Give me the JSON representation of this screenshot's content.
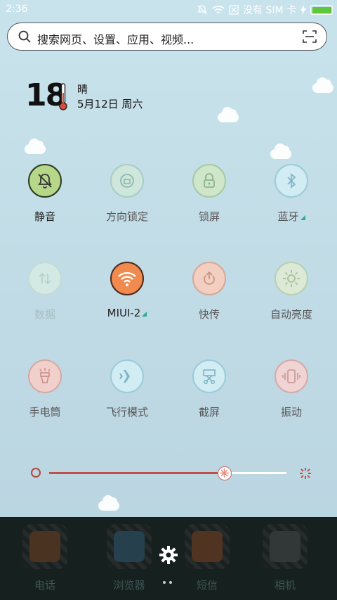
{
  "status_bar": {
    "time": "2:36",
    "carrier": "没有 SIM 卡",
    "battery_level": 100
  },
  "search": {
    "placeholder": "搜索网页、设置、应用、视频..."
  },
  "weather": {
    "temperature": "18",
    "condition": "晴",
    "date": "5月12日 周六"
  },
  "toggles": [
    {
      "label": "静音",
      "icon": "bell-off-icon",
      "color": "#b6d68a",
      "state": "on"
    },
    {
      "label": "方向锁定",
      "icon": "rotation-lock-icon",
      "color": "#cfe6dc",
      "state": "off"
    },
    {
      "label": "锁屏",
      "icon": "lock-icon",
      "color": "#cfe6c9",
      "state": "off"
    },
    {
      "label": "蓝牙",
      "icon": "bluetooth-icon",
      "color": "#d2ecf3",
      "state": "off"
    },
    {
      "label": "数据",
      "icon": "data-arrows-icon",
      "color": "#d4e9e3",
      "state": "disabled"
    },
    {
      "label": "MIUI-2",
      "icon": "wifi-icon",
      "color": "#f08a4f",
      "state": "on"
    },
    {
      "label": "快传",
      "icon": "power-share-icon",
      "color": "#f3cfc1",
      "state": "off"
    },
    {
      "label": "自动亮度",
      "icon": "brightness-icon",
      "color": "#dce9d6",
      "state": "off"
    },
    {
      "label": "手电筒",
      "icon": "flashlight-icon",
      "color": "#f1d0cc",
      "state": "off"
    },
    {
      "label": "飞行模式",
      "icon": "airplane-icon",
      "color": "#d2ecf3",
      "state": "off"
    },
    {
      "label": "截屏",
      "icon": "screenshot-icon",
      "color": "#d2ecf3",
      "state": "off"
    },
    {
      "label": "振动",
      "icon": "vibrate-icon",
      "color": "#f0d3d3",
      "state": "off"
    }
  ],
  "brightness": {
    "value": 0.74
  },
  "dock": [
    {
      "label": "电话",
      "icon": "phone-icon"
    },
    {
      "label": "浏览器",
      "icon": "browser-icon"
    },
    {
      "label": "短信",
      "icon": "sms-icon"
    },
    {
      "label": "相机",
      "icon": "camera-icon"
    }
  ]
}
